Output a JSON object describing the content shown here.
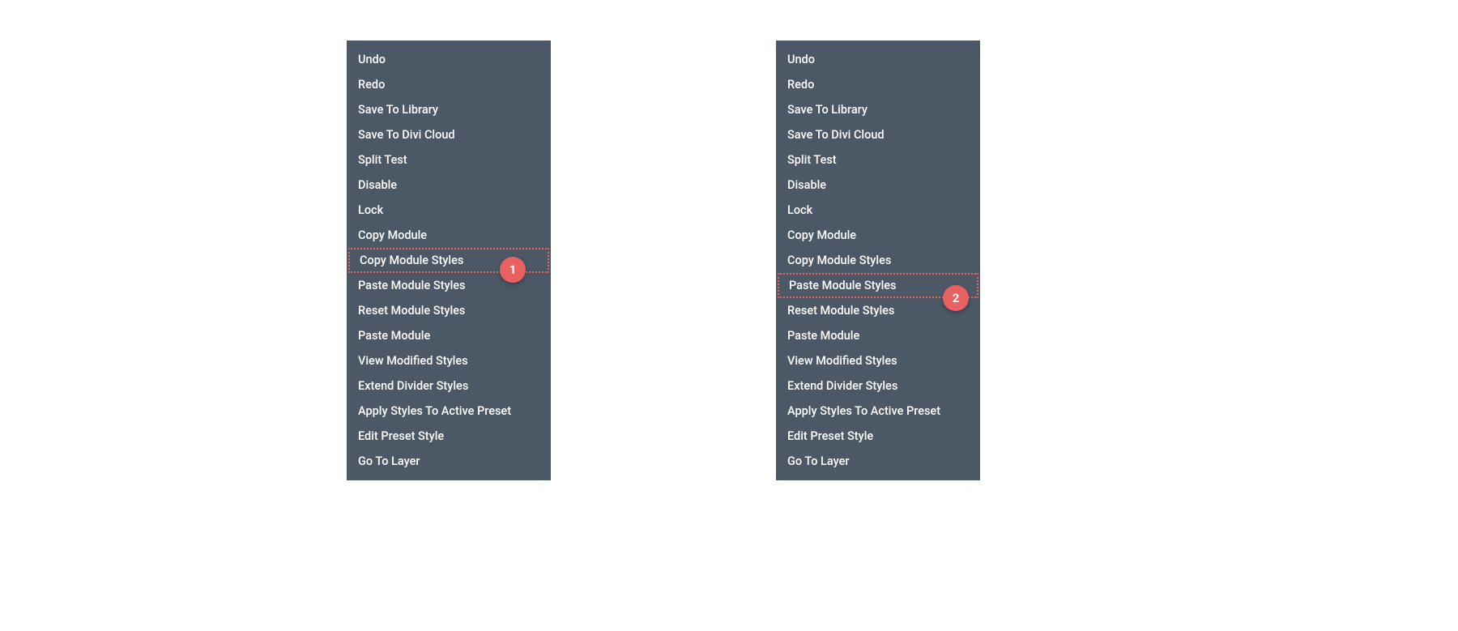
{
  "menu1": {
    "items": [
      {
        "label": "Undo",
        "highlighted": false
      },
      {
        "label": "Redo",
        "highlighted": false
      },
      {
        "label": "Save To Library",
        "highlighted": false
      },
      {
        "label": "Save To Divi Cloud",
        "highlighted": false
      },
      {
        "label": "Split Test",
        "highlighted": false
      },
      {
        "label": "Disable",
        "highlighted": false
      },
      {
        "label": "Lock",
        "highlighted": false
      },
      {
        "label": "Copy Module",
        "highlighted": false
      },
      {
        "label": "Copy Module Styles",
        "highlighted": true
      },
      {
        "label": "Paste Module Styles",
        "highlighted": false
      },
      {
        "label": "Reset Module Styles",
        "highlighted": false
      },
      {
        "label": "Paste Module",
        "highlighted": false
      },
      {
        "label": "View Modified Styles",
        "highlighted": false
      },
      {
        "label": "Extend Divider Styles",
        "highlighted": false
      },
      {
        "label": "Apply Styles To Active Preset",
        "highlighted": false
      },
      {
        "label": "Edit Preset Style",
        "highlighted": false
      },
      {
        "label": "Go To Layer",
        "highlighted": false
      }
    ]
  },
  "menu2": {
    "items": [
      {
        "label": "Undo",
        "highlighted": false
      },
      {
        "label": "Redo",
        "highlighted": false
      },
      {
        "label": "Save To Library",
        "highlighted": false
      },
      {
        "label": "Save To Divi Cloud",
        "highlighted": false
      },
      {
        "label": "Split Test",
        "highlighted": false
      },
      {
        "label": "Disable",
        "highlighted": false
      },
      {
        "label": "Lock",
        "highlighted": false
      },
      {
        "label": "Copy Module",
        "highlighted": false
      },
      {
        "label": "Copy Module Styles",
        "highlighted": false
      },
      {
        "label": "Paste Module Styles",
        "highlighted": true
      },
      {
        "label": "Reset Module Styles",
        "highlighted": false
      },
      {
        "label": "Paste Module",
        "highlighted": false
      },
      {
        "label": "View Modified Styles",
        "highlighted": false
      },
      {
        "label": "Extend Divider Styles",
        "highlighted": false
      },
      {
        "label": "Apply Styles To Active Preset",
        "highlighted": false
      },
      {
        "label": "Edit Preset Style",
        "highlighted": false
      },
      {
        "label": "Go To Layer",
        "highlighted": false
      }
    ]
  },
  "badges": {
    "one": "1",
    "two": "2"
  },
  "colors": {
    "menu_bg": "#4c5866",
    "highlight": "#e8605f",
    "text": "#ffffff"
  }
}
